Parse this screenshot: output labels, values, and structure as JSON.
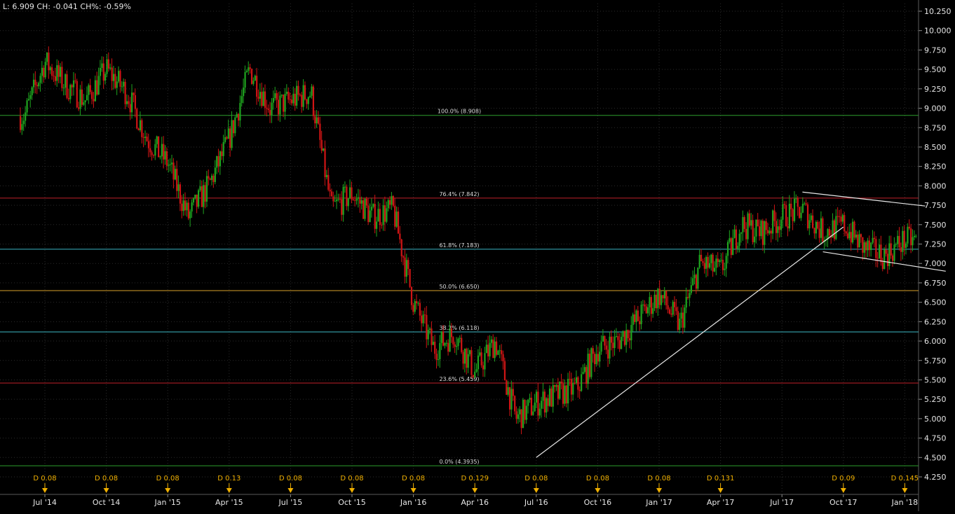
{
  "header": {
    "readout": "L: 6.909 CH: -0.041 CH%: -0.59%"
  },
  "colors": {
    "background": "#000000",
    "grid": "#2b2b2b",
    "up_bar": "#1fa51f",
    "down_bar": "#d01515",
    "dividend_marker": "#f0b000",
    "trendline": "#e8e8e8",
    "axis_text": "#e6e6e6"
  },
  "chart_data": {
    "type": "ohlc",
    "series_close": {
      "x": [
        "Jun '14",
        "Jul '14",
        "Aug '14",
        "Sep '14",
        "Oct '14",
        "Nov '14",
        "Dec '14",
        "Jan '15",
        "Feb '15",
        "Mar '15",
        "Apr '15",
        "May '15",
        "Jun '15",
        "Jul '15",
        "Aug '15",
        "Sep '15",
        "Oct '15",
        "Nov '15",
        "Dec '15",
        "Jan '16",
        "Feb '16",
        "Mar '16",
        "Apr '16",
        "May '16",
        "Jun '16",
        "Jul '16",
        "Aug '16",
        "Sep '16",
        "Oct '16",
        "Nov '16",
        "Dec '16",
        "Jan '17",
        "Feb '17",
        "Mar '17",
        "Apr '17",
        "May '17",
        "Jun '17",
        "Jul '17",
        "Aug '17",
        "Sep '17",
        "Oct '17",
        "Nov '17",
        "Dec '17",
        "Jan '18",
        "Feb '18",
        "Mar '18"
      ],
      "y": [
        8.9,
        9.6,
        9.3,
        9.1,
        9.5,
        9.2,
        8.6,
        8.3,
        7.6,
        8.0,
        8.6,
        9.5,
        9.0,
        9.1,
        9.2,
        7.7,
        7.9,
        7.6,
        7.7,
        6.5,
        5.9,
        6.1,
        5.6,
        6.0,
        5.0,
        5.2,
        5.3,
        5.4,
        5.9,
        6.0,
        6.3,
        6.6,
        6.2,
        7.0,
        6.9,
        7.5,
        7.4,
        7.6,
        7.7,
        7.4,
        7.5,
        7.2,
        7.1,
        7.3,
        7.3,
        6.909
      ]
    },
    "y_axis": {
      "min": 4.25,
      "max": 10.25,
      "ticks": [
        "4.250",
        "4.500",
        "4.750",
        "5.000",
        "5.250",
        "5.500",
        "5.750",
        "6.000",
        "6.250",
        "6.500",
        "6.750",
        "7.000",
        "7.250",
        "7.500",
        "7.750",
        "8.000",
        "8.250",
        "8.500",
        "8.750",
        "9.000",
        "9.250",
        "9.500",
        "9.750",
        "10.000",
        "10.250"
      ]
    },
    "x_axis": {
      "ticks": [
        "Jul '14",
        "Oct '14",
        "Jan '15",
        "Apr '15",
        "Jul '15",
        "Oct '15",
        "Jan '16",
        "Apr '16",
        "Jul '16",
        "Oct '16",
        "Jan '17",
        "Apr '17",
        "Jul '17",
        "Oct '17",
        "Jan '18"
      ]
    },
    "fibonacci_levels": [
      {
        "label": "100.0% (8.908)",
        "value": 8.908,
        "color": "#2e9e2e"
      },
      {
        "label": "76.4% (7.842)",
        "value": 7.842,
        "color": "#c0202a"
      },
      {
        "label": "61.8% (7.183)",
        "value": 7.183,
        "color": "#3bb7c4"
      },
      {
        "label": "50.0% (6.650)",
        "value": 6.65,
        "color": "#d9a12a"
      },
      {
        "label": "38.2% (6.118)",
        "value": 6.118,
        "color": "#3bb7c4"
      },
      {
        "label": "23.6% (5.459)",
        "value": 5.459,
        "color": "#c0202a"
      },
      {
        "label": "0.0% (4.3935)",
        "value": 4.3935,
        "color": "#2e9e2e"
      }
    ],
    "dividends": [
      {
        "label": "D 0.08",
        "date": "Jul '14"
      },
      {
        "label": "D 0.08",
        "date": "Oct '14"
      },
      {
        "label": "D 0.08",
        "date": "Jan '15"
      },
      {
        "label": "D 0.13",
        "date": "Apr '15"
      },
      {
        "label": "D 0.08",
        "date": "Jul '15"
      },
      {
        "label": "D 0.08",
        "date": "Oct '15"
      },
      {
        "label": "D 0.08",
        "date": "Jan '16"
      },
      {
        "label": "D 0.129",
        "date": "Apr '16"
      },
      {
        "label": "D 0.08",
        "date": "Jul '16"
      },
      {
        "label": "D 0.08",
        "date": "Oct '16"
      },
      {
        "label": "D 0.08",
        "date": "Jan '17"
      },
      {
        "label": "D 0.131",
        "date": "Apr '17"
      },
      {
        "label": "D 0.09",
        "date": "Oct '17"
      },
      {
        "label": "D 0.145",
        "date": "Jan '18"
      }
    ],
    "trendlines": [
      {
        "from": {
          "date": "Jul '16",
          "value": 4.5
        },
        "to": {
          "date": "Oct '17",
          "value": 7.47
        }
      },
      {
        "from": {
          "date": "Aug '17",
          "value": 7.92
        },
        "to": {
          "date": "Feb '18",
          "value": 7.74
        }
      },
      {
        "from": {
          "date": "Sep '17",
          "value": 7.15
        },
        "to": {
          "date": "Mar '18",
          "value": 6.9
        }
      }
    ],
    "grid": true,
    "legend": "none"
  }
}
